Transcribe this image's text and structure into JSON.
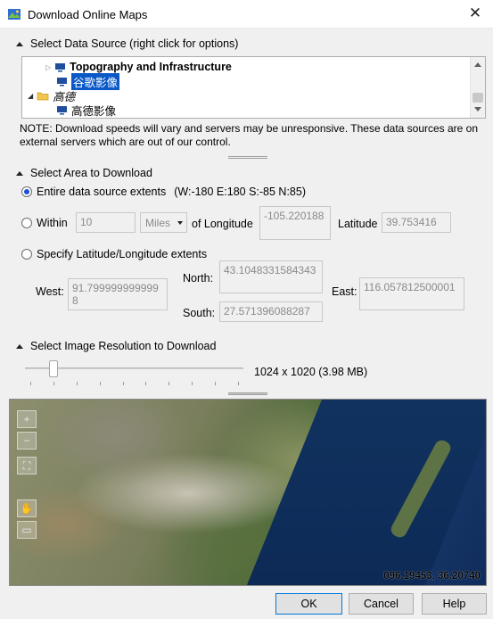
{
  "window": {
    "title": "Download Online Maps",
    "close": "✕"
  },
  "data_source": {
    "header": "Select Data Source (right click for options)",
    "items": [
      {
        "label": "Topography and Infrastructure"
      },
      {
        "label": "谷歌影像"
      },
      {
        "label": "高德"
      },
      {
        "label": "高德影像"
      }
    ]
  },
  "note": "NOTE: Download speeds will vary and servers may be unresponsive.  These data sources are on external servers which are out of our control.",
  "area": {
    "header": "Select Area to Download",
    "entire_label": "Entire data source extents",
    "entire_extents": "(W:-180 E:180 S:-85 N:85)",
    "within_label": "Within",
    "within_value": "10",
    "units": "Miles",
    "of_longitude_label": "of Longitude",
    "longitude_value": "-105.220188",
    "latitude_label": "Latitude",
    "latitude_value": "39.753416",
    "specify_label": "Specify Latitude/Longitude extents",
    "west_label": "West:",
    "west_value": "91.7999999999998",
    "north_label": "North:",
    "north_value": "43.1048331584343",
    "east_label": "East:",
    "east_value": "116.057812500001",
    "south_label": "South:",
    "south_value": "27.571396088287"
  },
  "resolution": {
    "header": "Select Image Resolution to Download",
    "value_text": "1024 x 1020  (3.98 MB)",
    "slider_level_fraction": 0.13
  },
  "map": {
    "coordinates": "096.19453, 36.20740"
  },
  "buttons": {
    "ok": "OK",
    "cancel": "Cancel",
    "help": "Help"
  }
}
